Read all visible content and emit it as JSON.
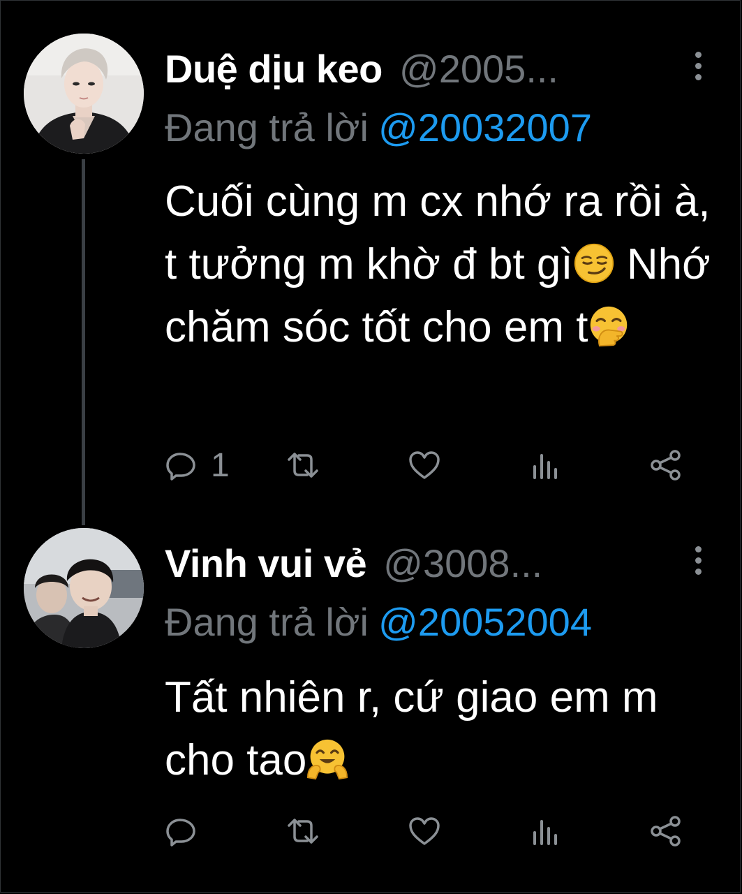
{
  "tweets": [
    {
      "display_name": "Duệ dịu keo",
      "handle": "@2005...",
      "reply_prefix": "Đang trả lời",
      "reply_to": "@20032007",
      "text_parts": {
        "part1": "Cuối cùng m cx nhớ ra rồi à, t tưởng m khờ đ bt gì",
        "emoji1": "smirking-face",
        "part2": " Nhớ chăm sóc tốt cho em t",
        "emoji2": "face-with-hand-over-mouth"
      },
      "actions": {
        "reply_count": "1",
        "retweet_count": "",
        "like_count": "",
        "views_count": ""
      }
    },
    {
      "display_name": "Vinh vui vẻ",
      "handle": "@3008...",
      "reply_prefix": "Đang trả lời",
      "reply_to": "@20052004",
      "text_parts": {
        "part1": "Tất nhiên r, cứ giao em m cho tao",
        "emoji1": "hugging-face"
      },
      "actions": {
        "reply_count": "",
        "retweet_count": "",
        "like_count": "",
        "views_count": ""
      }
    }
  ],
  "icons": {
    "reply": "reply-icon",
    "retweet": "retweet-icon",
    "like": "heart-icon",
    "views": "views-icon",
    "share": "share-icon",
    "more": "more-icon"
  },
  "colors": {
    "background": "#000000",
    "text": "#ffffff",
    "muted": "#71767b",
    "link": "#1d9bf0",
    "icon": "#8b9095"
  }
}
